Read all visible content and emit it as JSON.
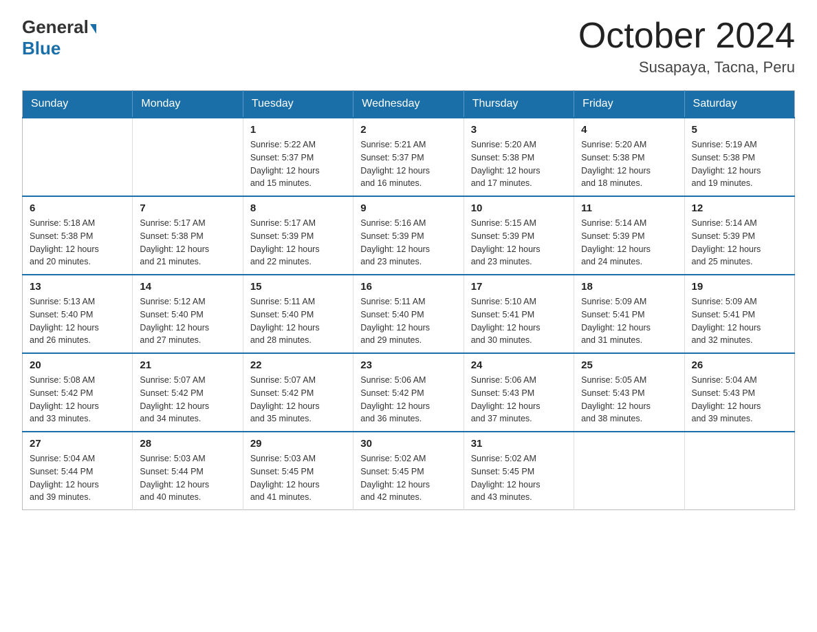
{
  "logo": {
    "general": "General",
    "blue": "Blue"
  },
  "title": "October 2024",
  "subtitle": "Susapaya, Tacna, Peru",
  "weekdays": [
    "Sunday",
    "Monday",
    "Tuesday",
    "Wednesday",
    "Thursday",
    "Friday",
    "Saturday"
  ],
  "weeks": [
    [
      {
        "day": "",
        "info": ""
      },
      {
        "day": "",
        "info": ""
      },
      {
        "day": "1",
        "info": "Sunrise: 5:22 AM\nSunset: 5:37 PM\nDaylight: 12 hours\nand 15 minutes."
      },
      {
        "day": "2",
        "info": "Sunrise: 5:21 AM\nSunset: 5:37 PM\nDaylight: 12 hours\nand 16 minutes."
      },
      {
        "day": "3",
        "info": "Sunrise: 5:20 AM\nSunset: 5:38 PM\nDaylight: 12 hours\nand 17 minutes."
      },
      {
        "day": "4",
        "info": "Sunrise: 5:20 AM\nSunset: 5:38 PM\nDaylight: 12 hours\nand 18 minutes."
      },
      {
        "day": "5",
        "info": "Sunrise: 5:19 AM\nSunset: 5:38 PM\nDaylight: 12 hours\nand 19 minutes."
      }
    ],
    [
      {
        "day": "6",
        "info": "Sunrise: 5:18 AM\nSunset: 5:38 PM\nDaylight: 12 hours\nand 20 minutes."
      },
      {
        "day": "7",
        "info": "Sunrise: 5:17 AM\nSunset: 5:38 PM\nDaylight: 12 hours\nand 21 minutes."
      },
      {
        "day": "8",
        "info": "Sunrise: 5:17 AM\nSunset: 5:39 PM\nDaylight: 12 hours\nand 22 minutes."
      },
      {
        "day": "9",
        "info": "Sunrise: 5:16 AM\nSunset: 5:39 PM\nDaylight: 12 hours\nand 23 minutes."
      },
      {
        "day": "10",
        "info": "Sunrise: 5:15 AM\nSunset: 5:39 PM\nDaylight: 12 hours\nand 23 minutes."
      },
      {
        "day": "11",
        "info": "Sunrise: 5:14 AM\nSunset: 5:39 PM\nDaylight: 12 hours\nand 24 minutes."
      },
      {
        "day": "12",
        "info": "Sunrise: 5:14 AM\nSunset: 5:39 PM\nDaylight: 12 hours\nand 25 minutes."
      }
    ],
    [
      {
        "day": "13",
        "info": "Sunrise: 5:13 AM\nSunset: 5:40 PM\nDaylight: 12 hours\nand 26 minutes."
      },
      {
        "day": "14",
        "info": "Sunrise: 5:12 AM\nSunset: 5:40 PM\nDaylight: 12 hours\nand 27 minutes."
      },
      {
        "day": "15",
        "info": "Sunrise: 5:11 AM\nSunset: 5:40 PM\nDaylight: 12 hours\nand 28 minutes."
      },
      {
        "day": "16",
        "info": "Sunrise: 5:11 AM\nSunset: 5:40 PM\nDaylight: 12 hours\nand 29 minutes."
      },
      {
        "day": "17",
        "info": "Sunrise: 5:10 AM\nSunset: 5:41 PM\nDaylight: 12 hours\nand 30 minutes."
      },
      {
        "day": "18",
        "info": "Sunrise: 5:09 AM\nSunset: 5:41 PM\nDaylight: 12 hours\nand 31 minutes."
      },
      {
        "day": "19",
        "info": "Sunrise: 5:09 AM\nSunset: 5:41 PM\nDaylight: 12 hours\nand 32 minutes."
      }
    ],
    [
      {
        "day": "20",
        "info": "Sunrise: 5:08 AM\nSunset: 5:42 PM\nDaylight: 12 hours\nand 33 minutes."
      },
      {
        "day": "21",
        "info": "Sunrise: 5:07 AM\nSunset: 5:42 PM\nDaylight: 12 hours\nand 34 minutes."
      },
      {
        "day": "22",
        "info": "Sunrise: 5:07 AM\nSunset: 5:42 PM\nDaylight: 12 hours\nand 35 minutes."
      },
      {
        "day": "23",
        "info": "Sunrise: 5:06 AM\nSunset: 5:42 PM\nDaylight: 12 hours\nand 36 minutes."
      },
      {
        "day": "24",
        "info": "Sunrise: 5:06 AM\nSunset: 5:43 PM\nDaylight: 12 hours\nand 37 minutes."
      },
      {
        "day": "25",
        "info": "Sunrise: 5:05 AM\nSunset: 5:43 PM\nDaylight: 12 hours\nand 38 minutes."
      },
      {
        "day": "26",
        "info": "Sunrise: 5:04 AM\nSunset: 5:43 PM\nDaylight: 12 hours\nand 39 minutes."
      }
    ],
    [
      {
        "day": "27",
        "info": "Sunrise: 5:04 AM\nSunset: 5:44 PM\nDaylight: 12 hours\nand 39 minutes."
      },
      {
        "day": "28",
        "info": "Sunrise: 5:03 AM\nSunset: 5:44 PM\nDaylight: 12 hours\nand 40 minutes."
      },
      {
        "day": "29",
        "info": "Sunrise: 5:03 AM\nSunset: 5:45 PM\nDaylight: 12 hours\nand 41 minutes."
      },
      {
        "day": "30",
        "info": "Sunrise: 5:02 AM\nSunset: 5:45 PM\nDaylight: 12 hours\nand 42 minutes."
      },
      {
        "day": "31",
        "info": "Sunrise: 5:02 AM\nSunset: 5:45 PM\nDaylight: 12 hours\nand 43 minutes."
      },
      {
        "day": "",
        "info": ""
      },
      {
        "day": "",
        "info": ""
      }
    ]
  ]
}
